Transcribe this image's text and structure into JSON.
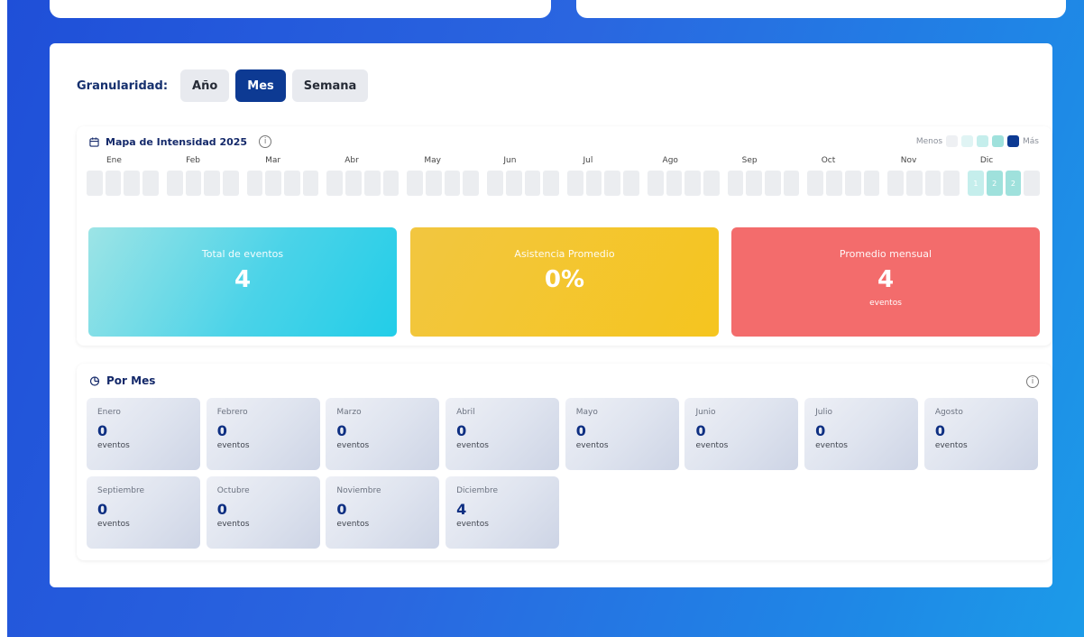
{
  "granularity": {
    "label": "Granularidad:",
    "options": [
      "Año",
      "Mes",
      "Semana"
    ],
    "selected": "Mes"
  },
  "heatmap": {
    "title": "Mapa de Intensidad 2025",
    "legend_less": "Menos",
    "legend_more": "Más",
    "legend_colors": [
      "#eef0f3",
      "#e0f4f4",
      "#c5eeec",
      "#9fe1dc",
      "#0d3a93"
    ],
    "months": [
      "Ene",
      "Feb",
      "Mar",
      "Abr",
      "May",
      "Jun",
      "Jul",
      "Ago",
      "Sep",
      "Oct",
      "Nov",
      "Dic"
    ],
    "dec_values": [
      "1",
      "2",
      "2"
    ]
  },
  "stats": {
    "total": {
      "label": "Total de eventos",
      "value": "4"
    },
    "attendance": {
      "label": "Asistencia Promedio",
      "value": "0%"
    },
    "monthly": {
      "label": "Promedio mensual",
      "value": "4",
      "unit": "eventos"
    }
  },
  "por_mes": {
    "title": "Por Mes",
    "unit": "eventos",
    "months": [
      {
        "name": "Enero",
        "value": "0"
      },
      {
        "name": "Febrero",
        "value": "0"
      },
      {
        "name": "Marzo",
        "value": "0"
      },
      {
        "name": "Abril",
        "value": "0"
      },
      {
        "name": "Mayo",
        "value": "0"
      },
      {
        "name": "Junio",
        "value": "0"
      },
      {
        "name": "Julio",
        "value": "0"
      },
      {
        "name": "Agosto",
        "value": "0"
      },
      {
        "name": "Septiembre",
        "value": "0"
      },
      {
        "name": "Octubre",
        "value": "0"
      },
      {
        "name": "Noviembre",
        "value": "0"
      },
      {
        "name": "Diciembre",
        "value": "4"
      }
    ]
  },
  "colors": {
    "accent": "#0d3a93",
    "stat_total": "#22cde8",
    "stat_attendance": "#f5c51f",
    "stat_monthly": "#f36c6c"
  }
}
